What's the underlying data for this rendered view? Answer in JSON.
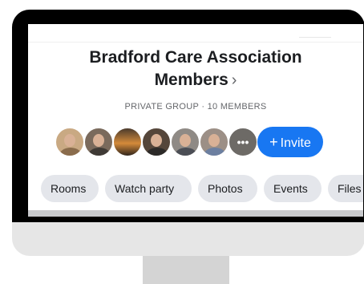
{
  "group": {
    "title": "Bradford Care Association Members",
    "title_chevron": "›",
    "meta": "PRIVATE GROUP · 10 MEMBERS"
  },
  "members": {
    "more_glyph": "•••",
    "avatar_colors": [
      "#c9a983",
      "#7a6a5c",
      "#b06a2e",
      "#55463a",
      "#8f8a85",
      "#9c8f86",
      "#6d6a66"
    ]
  },
  "invite": {
    "plus": "+",
    "label": "Invite"
  },
  "tabs": [
    {
      "label": "Rooms"
    },
    {
      "label": "Watch party"
    },
    {
      "label": "Photos"
    },
    {
      "label": "Events"
    },
    {
      "label": "Files"
    }
  ],
  "colors": {
    "accent": "#1877f2",
    "chip": "#e4e6eb",
    "text": "#1c1e21",
    "muted": "#65676b"
  }
}
